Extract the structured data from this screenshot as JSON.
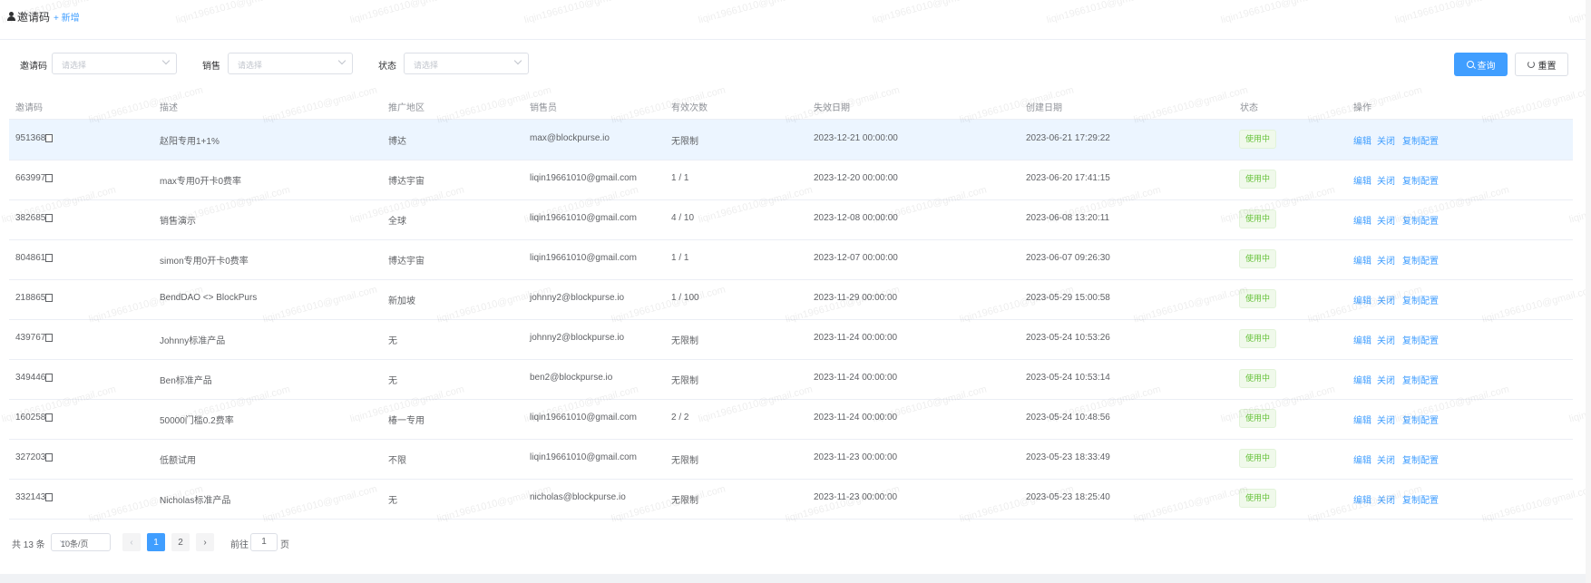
{
  "header": {
    "title": "邀请码",
    "add_label": "+ 新增"
  },
  "filters": [
    {
      "label": "邀请码",
      "placeholder": "请选择"
    },
    {
      "label": "销售",
      "placeholder": "请选择"
    },
    {
      "label": "状态",
      "placeholder": "请选择"
    }
  ],
  "buttons": {
    "search": "查询",
    "reset": "重置"
  },
  "table": {
    "columns": [
      "邀请码",
      "描述",
      "推广地区",
      "销售员",
      "有效次数",
      "失效日期",
      "创建日期",
      "状态",
      "操作"
    ],
    "actions": {
      "edit": "编辑",
      "close": "关闭",
      "copy_config": "复制配置"
    },
    "rows": [
      {
        "code": "951368",
        "desc": "赵阳专用1+1%",
        "region": "博达",
        "sales": "max@blockpurse.io",
        "count": "无限制",
        "expire": "2023-12-21 00:00:00",
        "created": "2023-06-21 17:29:22",
        "status": "使用中"
      },
      {
        "code": "663997",
        "desc": "max专用0开卡0费率",
        "region": "博达宇宙",
        "sales": "liqin19661010@gmail.com",
        "count": "1 / 1",
        "expire": "2023-12-20 00:00:00",
        "created": "2023-06-20 17:41:15",
        "status": "使用中"
      },
      {
        "code": "382685",
        "desc": "销售演示",
        "region": "全球",
        "sales": "liqin19661010@gmail.com",
        "count": "4 / 10",
        "expire": "2023-12-08 00:00:00",
        "created": "2023-06-08 13:20:11",
        "status": "使用中"
      },
      {
        "code": "804861",
        "desc": "simon专用0开卡0费率",
        "region": "博达宇宙",
        "sales": "liqin19661010@gmail.com",
        "count": "1 / 1",
        "expire": "2023-12-07 00:00:00",
        "created": "2023-06-07 09:26:30",
        "status": "使用中"
      },
      {
        "code": "218865",
        "desc": "BendDAO <> BlockPurs",
        "region": "新加坡",
        "sales": "johnny2@blockpurse.io",
        "count": "1 / 100",
        "expire": "2023-11-29 00:00:00",
        "created": "2023-05-29 15:00:58",
        "status": "使用中"
      },
      {
        "code": "439767",
        "desc": "Johnny标准产品",
        "region": "无",
        "sales": "johnny2@blockpurse.io",
        "count": "无限制",
        "expire": "2023-11-24 00:00:00",
        "created": "2023-05-24 10:53:26",
        "status": "使用中"
      },
      {
        "code": "349446",
        "desc": "Ben标准产品",
        "region": "无",
        "sales": "ben2@blockpurse.io",
        "count": "无限制",
        "expire": "2023-11-24 00:00:00",
        "created": "2023-05-24 10:53:14",
        "status": "使用中"
      },
      {
        "code": "160258",
        "desc": "50000门槛0.2费率",
        "region": "椿一专用",
        "sales": "liqin19661010@gmail.com",
        "count": "2 / 2",
        "expire": "2023-11-24 00:00:00",
        "created": "2023-05-24 10:48:56",
        "status": "使用中"
      },
      {
        "code": "327203",
        "desc": "低额试用",
        "region": "不限",
        "sales": "liqin19661010@gmail.com",
        "count": "无限制",
        "expire": "2023-11-23 00:00:00",
        "created": "2023-05-23 18:33:49",
        "status": "使用中"
      },
      {
        "code": "332143",
        "desc": "Nicholas标准产品",
        "region": "无",
        "sales": "nicholas@blockpurse.io",
        "count": "无限制",
        "expire": "2023-11-23 00:00:00",
        "created": "2023-05-23 18:25:40",
        "status": "使用中"
      }
    ]
  },
  "pagination": {
    "total": "共 13 条",
    "page_size": "10条/页",
    "prev": "‹",
    "next": "›",
    "pages": [
      "1",
      "2"
    ],
    "current": "1",
    "goto_label": "前往",
    "goto_value": "1",
    "page_suffix": "页"
  },
  "watermark": "liqin19661010@gmail.com",
  "colors": {
    "primary": "#409eff",
    "success": "#67c23a",
    "row_highlight": "#ecf5ff"
  }
}
